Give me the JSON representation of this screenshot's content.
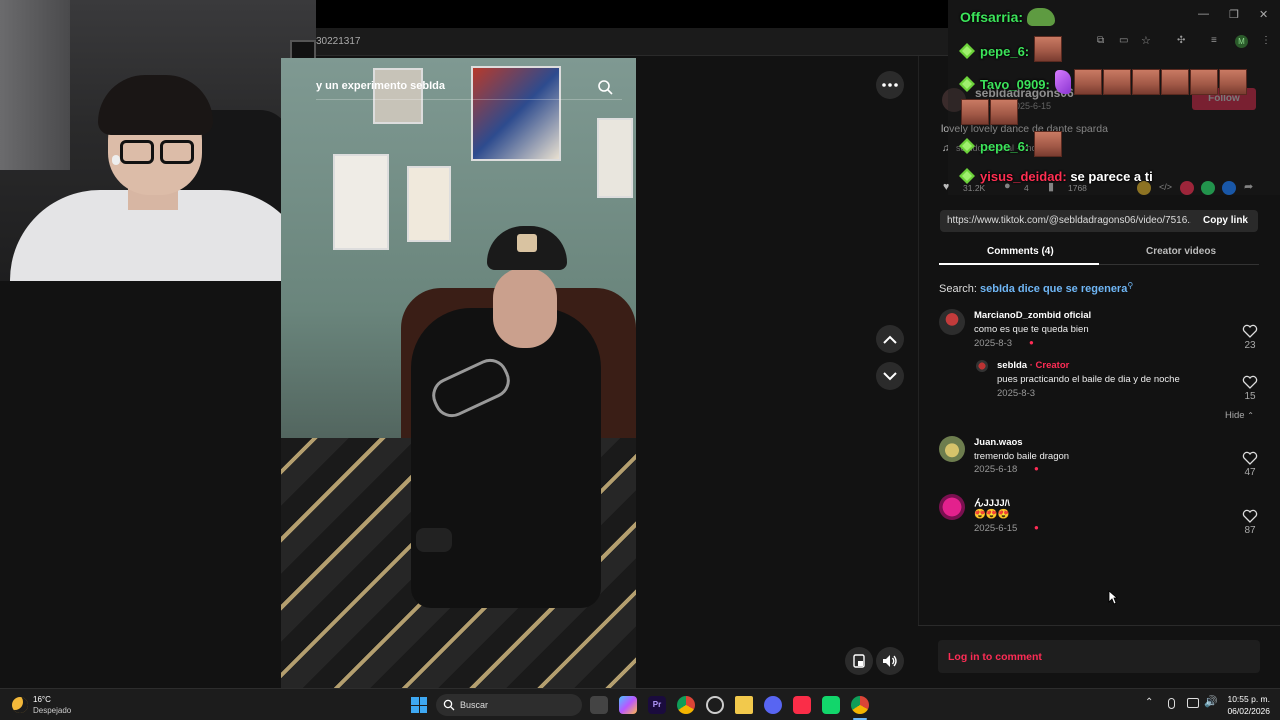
{
  "browser": {
    "address_fragment": "30221317",
    "window_controls": {
      "minimize": "—",
      "restore": "❐",
      "close": "✕"
    },
    "profile_letter": "M"
  },
  "video": {
    "search_text": "y un experimento sebIda"
  },
  "background_info": {
    "author_handle": "sebldadragons06",
    "author_sub": "sebIda · 2025-6-15",
    "follow_label": "Follow",
    "description": "lovely lovely dance de dante sparda",
    "sound": "sonido original - knock",
    "likes": "31.2K",
    "comments": "4",
    "saves": "1768"
  },
  "share": {
    "url": "https://www.tiktok.com/@sebldadragons06/video/7516...",
    "copy_label": "Copy link"
  },
  "tabs": {
    "comments": "Comments (4)",
    "creator": "Creator videos"
  },
  "search": {
    "prefix": "Search:",
    "query": "sebIda dice que se regenera"
  },
  "comments": [
    {
      "user": "MarcianoD_zombid oficial",
      "text": "como es que te queda bien",
      "date": "2025-8-3",
      "likes": "23"
    },
    {
      "user": "sebIda",
      "creator_tag": "· Creator",
      "text": "pues practicando el baile de dia y de noche",
      "date": "2025-8-3",
      "likes": "15"
    },
    {
      "user": "Juan.waos",
      "text": "tremendo baile dragon",
      "date": "2025-6-18",
      "likes": "47"
    },
    {
      "user": "んJJJJ/\\",
      "text": "😍😍😍",
      "date": "2025-6-15",
      "likes": "87"
    }
  ],
  "hide_label": "Hide",
  "login_prompt": "Log in to comment",
  "chat": {
    "channel": "Offsarria:",
    "messages": [
      {
        "user": "pepe_6:",
        "text": ""
      },
      {
        "user": "Tavo_0909:",
        "text": ""
      },
      {
        "user": "pepe_6:",
        "text": ""
      },
      {
        "user": "yisus_deidad:",
        "text": "se parece a ti"
      }
    ]
  },
  "taskbar": {
    "temperature": "16°C",
    "weather": "Despejado",
    "search_placeholder": "Buscar",
    "time": "10:55 p. m.",
    "date": "06/02/2026"
  },
  "colors": {
    "accent": "#fe2c55",
    "link": "#6fb6f5",
    "chat_green": "#3ce35a"
  }
}
